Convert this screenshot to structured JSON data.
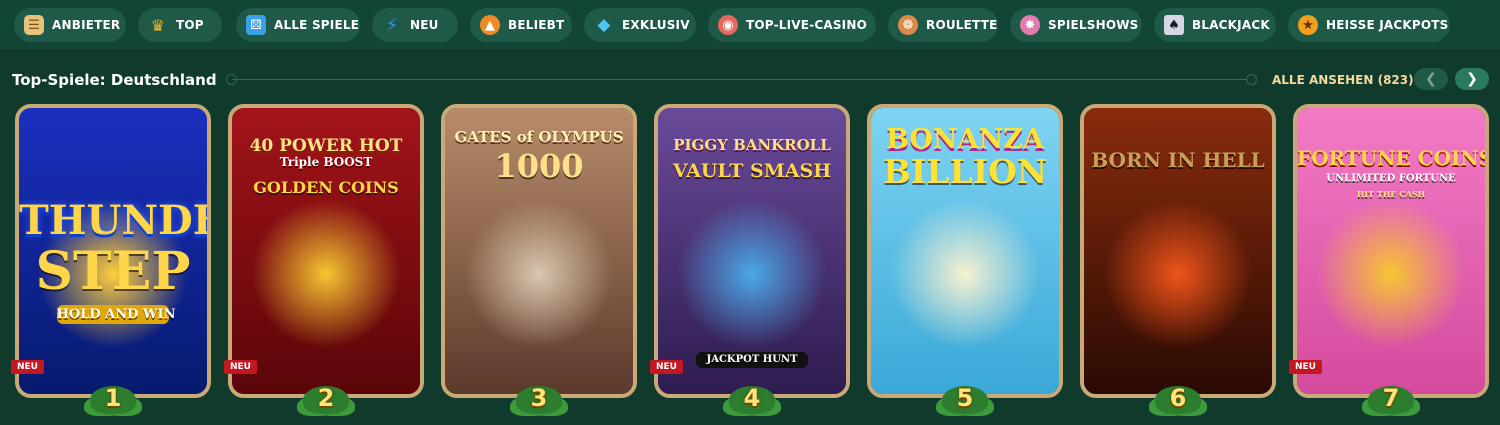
{
  "nav": {
    "items": [
      {
        "label": "ANBIETER",
        "icon": "scroll-icon",
        "color": "#e6c27a"
      },
      {
        "label": "TOP",
        "icon": "crown-icon",
        "color": "#f2b531"
      },
      {
        "label": "ALLE SPIELE",
        "icon": "dice-icon",
        "color": "#3aa1e8"
      },
      {
        "label": "NEU",
        "icon": "lightning-icon",
        "color": "#3d8ff0"
      },
      {
        "label": "BELIEBT",
        "icon": "flame-icon",
        "color": "#f08a24"
      },
      {
        "label": "EXKLUSIV",
        "icon": "diamond-icon",
        "color": "#4cc3f0"
      },
      {
        "label": "TOP-LIVE-CASINO",
        "icon": "chip-icon",
        "color": "#e8675f"
      },
      {
        "label": "ROULETTE",
        "icon": "roulette-icon",
        "color": "#d98b4a"
      },
      {
        "label": "SPIELSHOWS",
        "icon": "wheel-icon",
        "color": "#e27bb0"
      },
      {
        "label": "BLACKJACK",
        "icon": "cards-icon",
        "color": "#d6d6e6"
      },
      {
        "label": "HEISSE JACKPOTS",
        "icon": "hot-jackpot-icon",
        "color": "#f0a020"
      }
    ]
  },
  "section": {
    "title": "Top-Spiele: Deutschland",
    "view_all": "ALLE ANSEHEN (823)"
  },
  "games": [
    {
      "rank": "1",
      "line1": "THUNDER",
      "line2": "STEP",
      "line3": "HOLD AND WIN",
      "badge": "NEU",
      "bg1": "#1a2fbf",
      "bg2": "#071a6e",
      "glow": "#ffcf3a"
    },
    {
      "rank": "2",
      "line1": "40 POWER HOT",
      "line2": "Triple BOOST",
      "line3": "GOLDEN COINS",
      "badge": "NEU",
      "bg1": "#a3141a",
      "bg2": "#5a0508",
      "glow": "#f7c631"
    },
    {
      "rank": "3",
      "line1": "GATES of OLYMPUS",
      "line2": "1000",
      "line3": "",
      "badge": "",
      "bg1": "#b88c6a",
      "bg2": "#5b3a2c",
      "glow": "#d9c7b0"
    },
    {
      "rank": "4",
      "line1": "PIGGY BANKROLL",
      "line2": "VAULT SMASH",
      "line3": "JACKPOT HUNT",
      "badge": "NEU",
      "bg1": "#6a4a9a",
      "bg2": "#2e1c4f",
      "glow": "#4aa8e8"
    },
    {
      "rank": "5",
      "line1": "BONANZA",
      "line2": "BILLION",
      "line3": "",
      "badge": "",
      "bg1": "#7fd4f2",
      "bg2": "#3aa8d8",
      "glow": "#f7f1d0"
    },
    {
      "rank": "6",
      "line1": "BORN IN HELL",
      "line2": "",
      "line3": "",
      "badge": "",
      "bg1": "#8a2c0c",
      "bg2": "#2a0a04",
      "glow": "#f0541a"
    },
    {
      "rank": "7",
      "line1": "FORTUNE COINS",
      "line2": "UNLIMITED FORTUNE",
      "line3": "HIT THE CASH",
      "badge": "NEU",
      "bg1": "#f37bc6",
      "bg2": "#d44a9c",
      "glow": "#f7c631"
    }
  ]
}
